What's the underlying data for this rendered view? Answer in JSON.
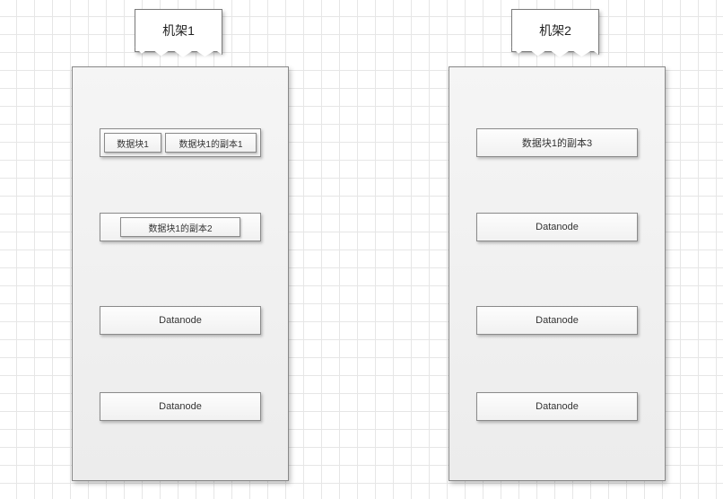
{
  "racks": {
    "r1": {
      "title": "机架1",
      "node1": {
        "block": "数据块1",
        "replica": "数据块1的副本1"
      },
      "node2": {
        "replica": "数据块1的副本2"
      },
      "node3": "Datanode",
      "node4": "Datanode"
    },
    "r2": {
      "title": "机架2",
      "node1": "数据块1的副本3",
      "node2": "Datanode",
      "node3": "Datanode",
      "node4": "Datanode"
    }
  }
}
